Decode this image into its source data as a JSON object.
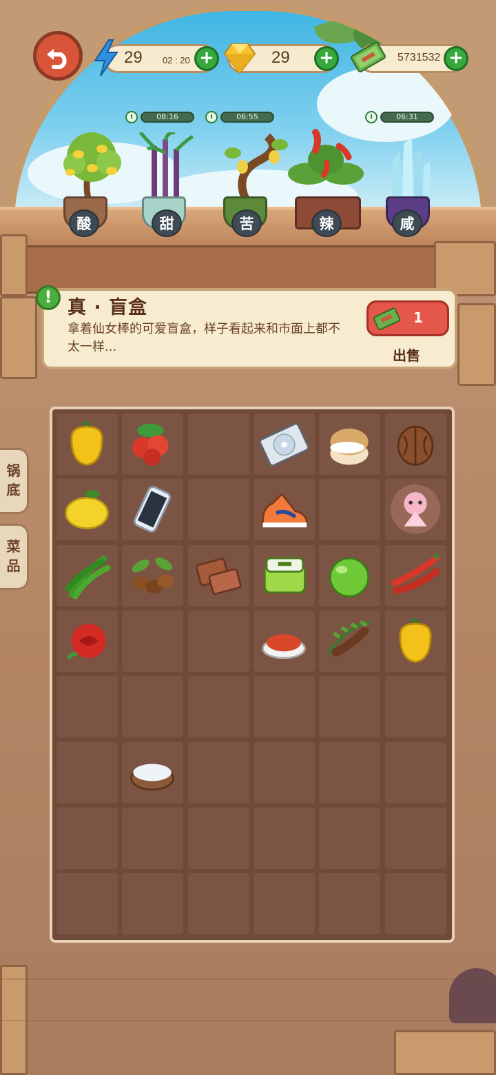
{
  "header": {
    "energy": {
      "icon": "lightning-icon",
      "value": "29",
      "timer": "02 : 20"
    },
    "gems": {
      "icon": "gem-icon",
      "value": "29"
    },
    "cash": {
      "icon": "cash-icon",
      "value": "5731532"
    }
  },
  "plants": [
    {
      "name": "lemon-tree",
      "flavor": "酸",
      "timer": "08:16",
      "pot_color": "#9b6a4a"
    },
    {
      "name": "sugarcane",
      "flavor": "甜",
      "timer": "",
      "pot_color": "#a8d3c9"
    },
    {
      "name": "bitter-melon-tree",
      "flavor": "苦",
      "timer": "06:55",
      "pot_color": "#5d8a3a"
    },
    {
      "name": "chili-plant",
      "flavor": "辣",
      "timer": "",
      "pot_color": "#8d4a37"
    },
    {
      "name": "salt-crystal",
      "flavor": "咸",
      "timer": "06:31",
      "pot_color": "#5c3e86"
    }
  ],
  "selected_item": {
    "title": "真 · 盲盒",
    "description": "拿着仙女棒的可爱盲盒，样子看起来和市面上都不太一样...",
    "sell_price": "1",
    "sell_label": "出售"
  },
  "side_tabs": [
    {
      "label": "锅\n底"
    },
    {
      "label": "菜\n品"
    }
  ],
  "inventory": [
    [
      "yellow-pepper",
      "red-berries",
      "",
      "cd-disc",
      "cream-puff",
      "walnut"
    ],
    [
      "lemon",
      "smartphone",
      "",
      "sneaker",
      "",
      "blind-box-doll"
    ],
    [
      "green-chili",
      "coffee-beans",
      "brown-sugar",
      "lunch-box",
      "lime",
      "red-chili"
    ],
    [
      "red-rose",
      "",
      "",
      "chili-powder",
      "tamarind",
      "yellow-pepper"
    ],
    [
      "",
      "",
      "",
      "",
      "",
      ""
    ],
    [
      "",
      "salt-bowl",
      "",
      "",
      "",
      ""
    ],
    [
      "",
      "",
      "",
      "",
      "",
      ""
    ],
    [
      "",
      "",
      "",
      "",
      "",
      ""
    ]
  ],
  "colors": {
    "accent_green": "#36a83c",
    "sell_red": "#e4574a",
    "panel_cream": "#f8ecd0"
  }
}
